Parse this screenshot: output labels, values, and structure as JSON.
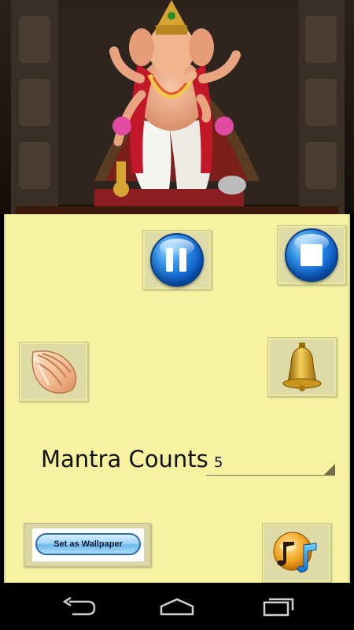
{
  "controls": {
    "pause": "pause-button",
    "stop": "stop-button",
    "conch": "conch-shell-icon",
    "bell": "bell-icon",
    "music": "music-icon"
  },
  "mantra": {
    "label": "Mantra Counts",
    "selected": "5"
  },
  "wallpaper": {
    "label": "Set as Wallpaper"
  },
  "nav": {
    "back": "back-icon",
    "home": "home-icon",
    "recents": "recents-icon"
  },
  "colors": {
    "panel": "#f6f2a1",
    "button_blue": "#0b5bc7",
    "navbar": "#000000"
  }
}
